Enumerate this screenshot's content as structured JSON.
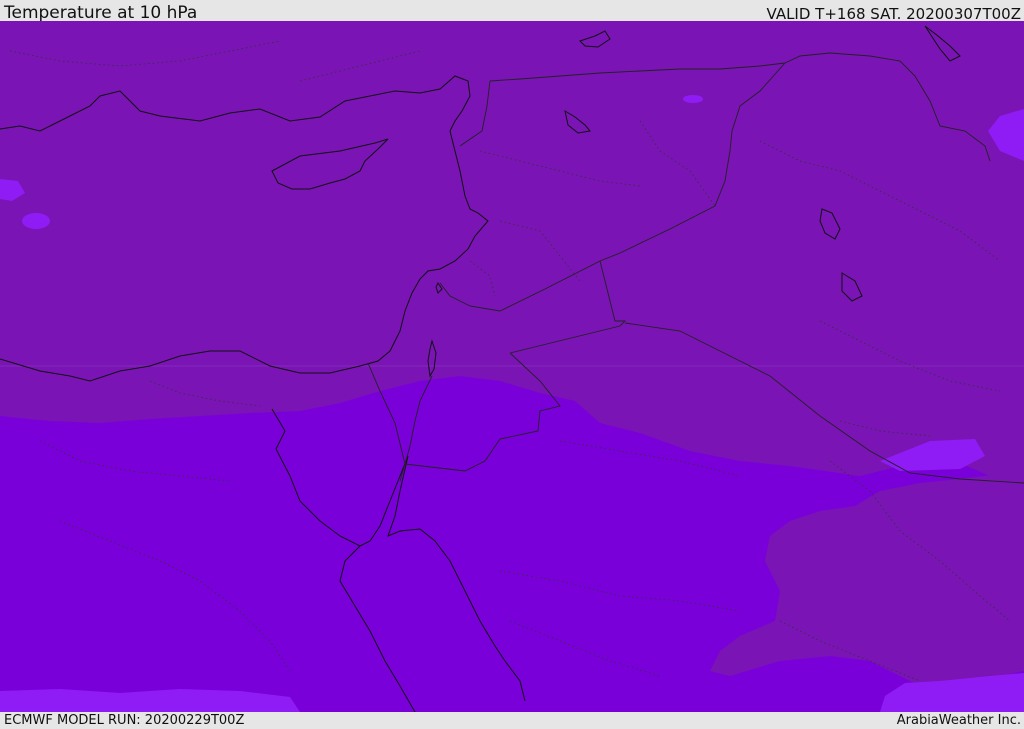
{
  "header": {
    "title": "Temperature at 10 hPa",
    "valid": "VALID T+168 SAT. 20200307T00Z"
  },
  "footer": {
    "model_run": "ECMWF MODEL RUN: 20200229T00Z",
    "credit": "ArabiaWeather Inc."
  },
  "map": {
    "fields": [
      {
        "name": "warmer-shade",
        "color": "#7a14b4"
      },
      {
        "name": "colder-shade",
        "color": "#7a00da"
      },
      {
        "name": "coldest-shade",
        "color": "#8f1cf4"
      }
    ],
    "linework": {
      "coastline": "#111111",
      "borders": "#222222"
    }
  }
}
